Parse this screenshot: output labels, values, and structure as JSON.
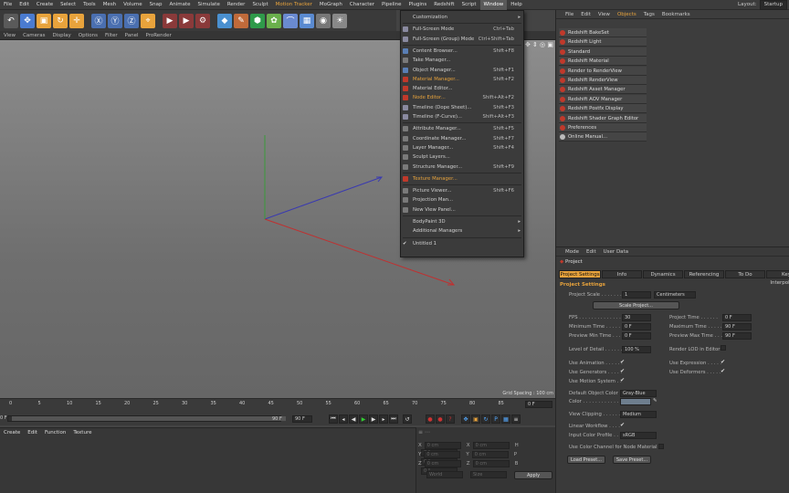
{
  "menubar": {
    "items": [
      "File",
      "Edit",
      "Create",
      "Select",
      "Tools",
      "Mesh",
      "Volume",
      "Snap",
      "Animate",
      "Simulate",
      "Render",
      "Sculpt",
      "Motion Tracker",
      "MoGraph",
      "Character",
      "Pipeline",
      "Plugins",
      "Redshift",
      "Script",
      "Window",
      "Help"
    ],
    "layout_label": "Layout:",
    "layout_value": "Startup"
  },
  "viewport": {
    "menu": [
      "View",
      "Cameras",
      "Display",
      "Options",
      "Filter",
      "Panel",
      "ProRender"
    ],
    "grid_spacing": "Grid Spacing : 100 cm",
    "nav_icons": "✥ ⇕ ◎ ▣"
  },
  "timeline": {
    "ticks": [
      "0",
      "5",
      "10",
      "15",
      "20",
      "25",
      "30",
      "35",
      "40",
      "45",
      "50",
      "55",
      "60",
      "65",
      "70",
      "75",
      "80",
      "85",
      "90"
    ],
    "frame": "0 F",
    "start": "0 F",
    "end_a": "90 F",
    "end_b": "90 F"
  },
  "matmgr": {
    "menu": [
      "Create",
      "Edit",
      "Function",
      "Texture"
    ]
  },
  "coords": {
    "rows": [
      [
        "X",
        "0 cm",
        "X",
        "0 cm",
        "H",
        "0 °"
      ],
      [
        "Y",
        "0 cm",
        "Y",
        "0 cm",
        "P",
        "0 °"
      ],
      [
        "Z",
        "0 cm",
        "Z",
        "0 cm",
        "B",
        "0 °"
      ]
    ],
    "mode_a": "World",
    "mode_b": "Size",
    "apply": "Apply"
  },
  "window_menu": {
    "items": [
      {
        "label": "Customization",
        "shortcut": "",
        "arrow": true,
        "color": ""
      },
      {
        "label": "Full-Screen Mode",
        "shortcut": "Ctrl+Tab",
        "color": "#8a8aa0"
      },
      {
        "label": "Full-Screen (Group) Mode",
        "shortcut": "Ctrl+Shift+Tab",
        "color": "#8a8aa0"
      },
      {
        "label": "Content Browser...",
        "shortcut": "Shift+F8",
        "color": "#5a7fb5"
      },
      {
        "label": "Take Manager...",
        "shortcut": "",
        "color": "#7a7a7a"
      },
      {
        "label": "Object Manager...",
        "shortcut": "Shift+F1",
        "color": "#5a7fb5"
      },
      {
        "label": "Material Manager...",
        "shortcut": "Shift+F2",
        "color": "#c0392b",
        "hl": true
      },
      {
        "label": "Material Editor...",
        "shortcut": "",
        "color": "#c0392b"
      },
      {
        "label": "Node Editor...",
        "shortcut": "Shift+Alt+F2",
        "color": "#c0392b",
        "hl": true
      },
      {
        "label": "Timeline (Dope Sheet)...",
        "shortcut": "Shift+F3",
        "color": "#8a8aa0"
      },
      {
        "label": "Timeline (F-Curve)...",
        "shortcut": "Shift+Alt+F3",
        "color": "#8a8aa0"
      },
      {
        "label": "Attribute Manager...",
        "shortcut": "Shift+F5",
        "color": "#7a7a7a"
      },
      {
        "label": "Coordinate Manager...",
        "shortcut": "Shift+F7",
        "color": "#7a7a7a"
      },
      {
        "label": "Layer Manager...",
        "shortcut": "Shift+F4",
        "color": "#7a7a7a"
      },
      {
        "label": "Sculpt Layers...",
        "shortcut": "",
        "color": "#7a7a7a"
      },
      {
        "label": "Structure Manager...",
        "shortcut": "Shift+F9",
        "color": "#7a7a7a"
      },
      {
        "label": "Texture Manager...",
        "shortcut": "",
        "color": "#c0392b",
        "hl": true
      },
      {
        "label": "Picture Viewer...",
        "shortcut": "Shift+F6",
        "color": "#7a7a7a"
      },
      {
        "label": "Projection Man...",
        "shortcut": "",
        "color": "#7a7a7a"
      },
      {
        "label": "New View Panel...",
        "shortcut": "",
        "color": "#7a7a7a"
      },
      {
        "label": "BodyPaint 3D",
        "shortcut": "",
        "arrow": true,
        "color": ""
      },
      {
        "label": "Additional Managers",
        "shortcut": "",
        "arrow": true,
        "color": ""
      },
      {
        "label": "Untitled 1",
        "shortcut": "",
        "color": "",
        "check": true
      }
    ]
  },
  "object_manager": {
    "menu": [
      "File",
      "Edit",
      "View",
      "Objects",
      "Tags",
      "Bookmarks"
    ],
    "items": [
      "Redshift BakeSet",
      "Redshift Light",
      "Standard",
      "Redshift Material",
      "Render to RenderView",
      "Redshift RenderView",
      "Redshift Asset Manager",
      "Redshift AOV Manager",
      "Redshift Postfx Display",
      "Redshift Shader Graph Editor",
      "Preferences",
      "Online Manual..."
    ]
  },
  "attributes": {
    "menu": [
      "Mode",
      "Edit",
      "User Data"
    ],
    "object_label": "Project",
    "tabs": [
      "Project Settings",
      "Info",
      "Dynamics",
      "Referencing",
      "To Do",
      "Key Interpolation"
    ],
    "section": "Project Settings",
    "project_scale_label": "Project Scale . . . . . . . .",
    "project_scale_value": "1",
    "project_scale_unit": "Centimeters",
    "scale_button": "Scale Project...",
    "fps_label": "FPS . . . . . . . . . . . . . . .",
    "fps_value": "30",
    "project_time_label": "Project Time . . . . . .",
    "project_time_value": "0 F",
    "min_time_label": "Minimum Time . . . . . .",
    "min_time_value": "0 F",
    "max_time_label": "Maximum Time . . . . .",
    "max_time_value": "90 F",
    "prev_min_label": "Preview Min Time . . .",
    "prev_min_value": "0 F",
    "prev_max_label": "Preview Max Time . . .",
    "prev_max_value": "90 F",
    "lod_label": "Level of Detail . . . . . .",
    "lod_value": "100 %",
    "render_lod_label": "Render LOD in Editor",
    "use_animation": "Use Animation . . . . . .",
    "use_expression": "Use Expression . . . . .",
    "use_generators": "Use Generators . . . . .",
    "use_deformers": "Use Deformers . . . . .",
    "use_motion": "Use Motion System . .",
    "default_color_label": "Default Object Color",
    "default_color_value": "Gray-Blue",
    "color_label": "Color . . . . . . . . . . . . . .",
    "view_clipping_label": "View Clipping . . . . . .",
    "view_clipping_value": "Medium",
    "linear_label": "Linear Workflow . . . .",
    "input_profile_label": "Input Color Profile . . .",
    "input_profile_value": "sRGB",
    "use_color_channel": "Use Color Channel for Node Material",
    "load_preset": "Load Preset...",
    "save_preset": "Save Preset..."
  },
  "check": "✔"
}
